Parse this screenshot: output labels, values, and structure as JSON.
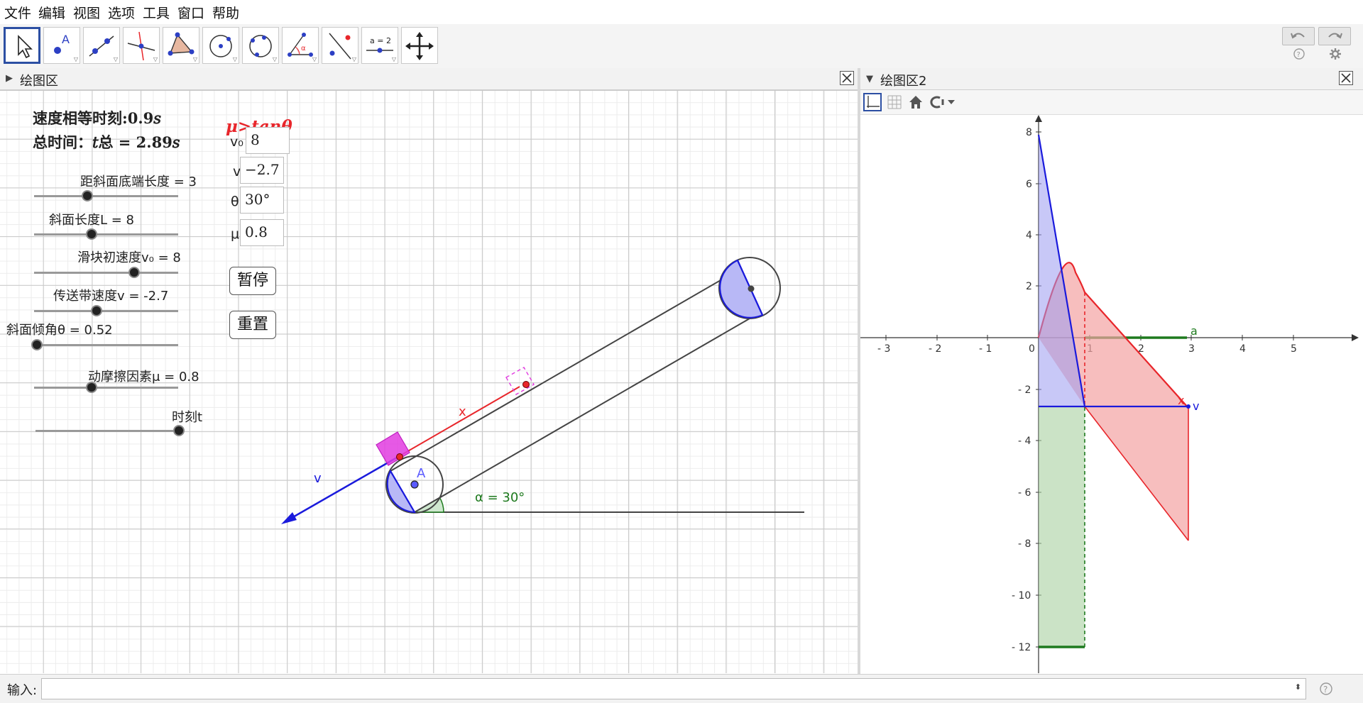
{
  "menu": [
    "文件",
    "编辑",
    "视图",
    "选项",
    "工具",
    "窗口",
    "帮助"
  ],
  "toolbar": {
    "equation_tool_label": "a = 2",
    "point_label": "A",
    "angle_label": "α"
  },
  "panel1": {
    "title": "绘图区",
    "info_equal_time": "速度相等时刻:0.9𝑠",
    "info_total_prefix": "总时间：",
    "info_total_formula": "𝑡总 = 2.89𝑠",
    "condition": "μ>tanθ",
    "sliders": [
      {
        "label": "距斜面底端长度 = 3",
        "fraction": 0.36
      },
      {
        "label": "斜面长度L = 8",
        "fraction": 0.4
      },
      {
        "label": "滑块初速度v₀ = 8",
        "fraction": 0.7
      },
      {
        "label": "传送带速度v = -2.7",
        "fraction": 0.44
      },
      {
        "label": "斜面倾角θ = 0.52",
        "fraction": 0.0
      },
      {
        "label": "动摩擦因素μ = 0.8",
        "fraction": 0.4
      },
      {
        "label": "时刻t",
        "fraction": 1.0
      }
    ],
    "inputs": [
      {
        "label": "v₀",
        "value": "8"
      },
      {
        "label": "v",
        "value": "−2.7"
      },
      {
        "label": "θ",
        "value": "30°"
      },
      {
        "label": "μ",
        "value": "0.8"
      }
    ],
    "buttons": {
      "pause": "暂停",
      "reset": "重置"
    },
    "canvas_labels": {
      "x": "x",
      "v": "v",
      "A": "A",
      "angle": "α = 30°"
    }
  },
  "panel2": {
    "title": "绘图区2",
    "x_ticks": [
      "- 3",
      "- 2",
      "- 1",
      "0",
      "1",
      "2",
      "3",
      "4",
      "5"
    ],
    "y_ticks": [
      "8",
      "6",
      "4",
      "2",
      "- 2",
      "- 4",
      "- 6",
      "- 8",
      "- 10",
      "- 12"
    ],
    "labels": {
      "a": "a",
      "v": "v",
      "x": "x"
    }
  },
  "inputbar": {
    "label": "输入:"
  },
  "colors": {
    "red": "#e8262b",
    "blue": "#1a1adc",
    "green": "#1e7a1e",
    "magenta": "#e23ce0",
    "select": "#2c4fa3"
  }
}
